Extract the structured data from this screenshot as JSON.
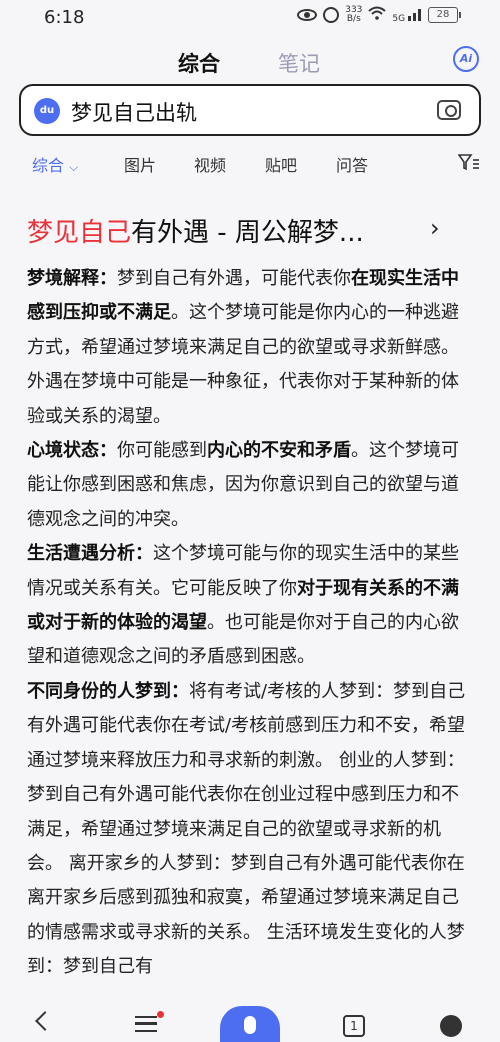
{
  "status_bar": {
    "time": "6:18",
    "speed_value": "333",
    "speed_unit": "B/s",
    "network": "5G",
    "battery": "28"
  },
  "top_tabs": {
    "active": "综合",
    "inactive": "笔记",
    "ai_label": "Ai"
  },
  "search": {
    "query": "梦见自己出轨"
  },
  "filter_tabs": [
    "综合",
    "图片",
    "视频",
    "贴吧",
    "问答"
  ],
  "result": {
    "title_highlight": "梦见自己",
    "title_rest": "有外遇 - 周公解梦...",
    "paragraphs": [
      {
        "label": "梦境解释：",
        "parts": [
          {
            "t": "梦到自己有外遇，可能代表你"
          },
          {
            "t": "在现实生活中感到压抑或不满足",
            "b": true
          },
          {
            "t": "。这个梦境可能是你内心的一种逃避方式，希望通过梦境来满足自己的欲望或寻求新鲜感。外遇在梦境中可能是一种象征，代表你对于某种新的体验或关系的渴望。"
          }
        ]
      },
      {
        "label": "心境状态：",
        "parts": [
          {
            "t": "你可能感到"
          },
          {
            "t": "内心的不安和矛盾",
            "b": true
          },
          {
            "t": "。这个梦境可能让你感到困惑和焦虑，因为你意识到自己的欲望与道德观念之间的冲突。"
          }
        ]
      },
      {
        "label": "生活遭遇分析：",
        "parts": [
          {
            "t": "这个梦境可能与你的现实生活中的某些情况或关系有关。它可能反映了你"
          },
          {
            "t": "对于现有关系的不满或对于新的体验的渴望",
            "b": true
          },
          {
            "t": "。也可能是你对于自己的内心欲望和道德观念之间的矛盾感到困惑。"
          }
        ]
      },
      {
        "label": "不同身份的人梦到：",
        "parts": [
          {
            "t": "将有考试/考核的人梦到：梦到自己有外遇可能代表你在考试/考核前感到压力和不安，希望通过梦境来释放压力和寻求新的刺激。 创业的人梦到：梦到自己有外遇可能代表你在创业过程中感到压力和不满足，希望通过梦境来满足自己的欲望或寻求新的机会。 离开家乡的人梦到：梦到自己有外遇可能代表你在离开家乡后感到孤独和寂寞，希望通过梦境来满足自己的情感需求或寻求新的关系。 生活环境发生变化的人梦到：梦到自己有"
          }
        ]
      }
    ]
  },
  "bottom_nav": {
    "tabs_count": "1"
  }
}
